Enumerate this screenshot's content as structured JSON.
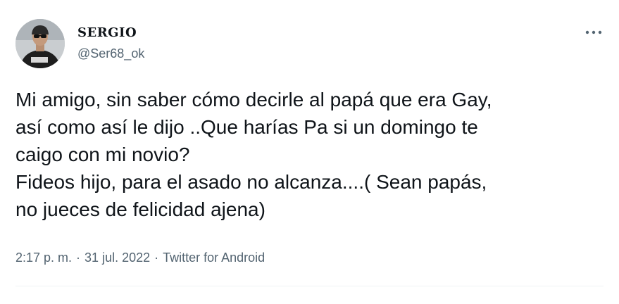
{
  "user": {
    "name": "SERGIO",
    "handle": "@Ser68_ok"
  },
  "tweet": {
    "text": "Mi amigo, sin saber cómo decirle al papá que era Gay,\nasí como así le dijo ..Que harías Pa si un domingo te\ncaigo con mi novio?\nFideos hijo, para el asado no alcanza....( Sean papás,\nno jueces de felicidad ajena)"
  },
  "meta": {
    "time": "2:17 p. m.",
    "separator1": "·",
    "date": "31 jul. 2022",
    "separator2": "·",
    "source": "Twitter for Android"
  },
  "icons": {
    "more": "more-horizontal-icon",
    "avatar": "profile-photo"
  },
  "colors": {
    "text": "#0f1419",
    "secondary": "#536471",
    "divider": "#eff3f4"
  }
}
